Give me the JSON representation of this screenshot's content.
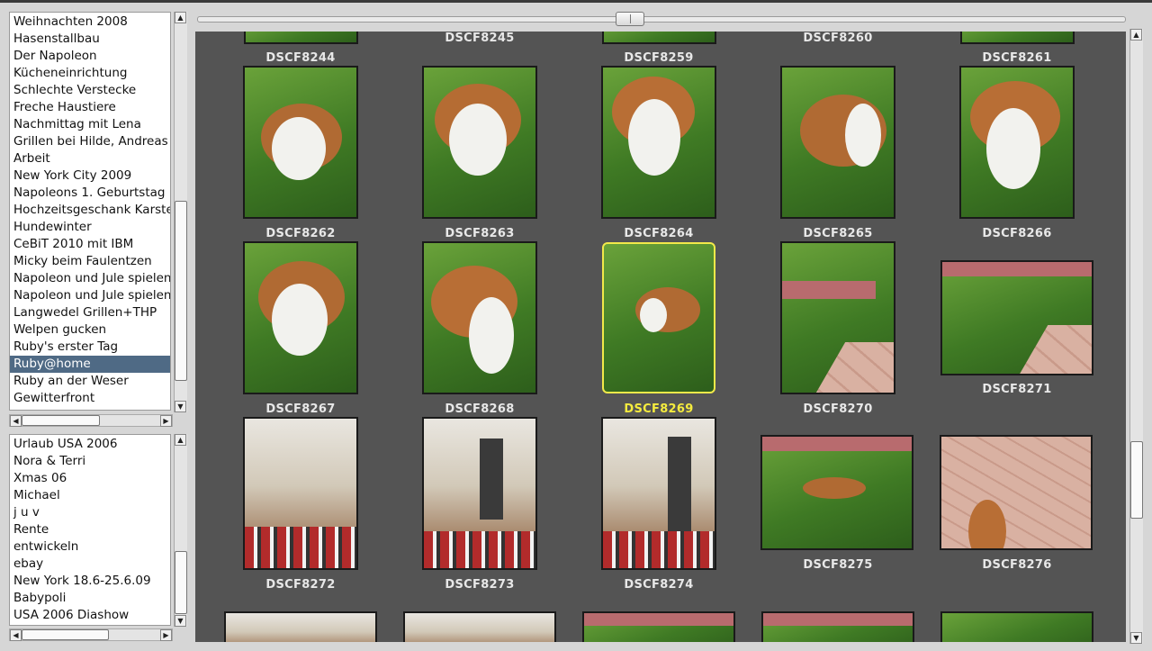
{
  "albums_top": {
    "items": [
      "Weihnachten 2008",
      "Hasenstallbau",
      "Der Napoleon",
      "Kücheneinrichtung",
      "Schlechte Verstecke",
      "Freche Haustiere",
      "Nachmittag mit Lena",
      "Grillen bei Hilde, Andreas u",
      "Arbeit",
      "New York City 2009",
      "Napoleons 1. Geburtstag",
      "Hochzeitsgeschank Karsten",
      "Hundewinter",
      "CeBiT 2010 mit IBM",
      "Micky beim Faulentzen",
      "Napoleon und Jule spielen",
      "Napoleon und Jule spielen",
      "Langwedel Grillen+THP",
      "Welpen gucken",
      "Ruby's erster Tag",
      "Ruby@home",
      "Ruby an der Weser",
      "Gewitterfront"
    ],
    "selected": "Ruby@home"
  },
  "albums_bottom": {
    "items": [
      "Urlaub USA 2006",
      "Nora & Terri",
      "Xmas 06",
      "Michael",
      "j u v",
      "Rente",
      "entwickeln",
      "ebay",
      "New York 18.6-25.6.09",
      "Babypoli",
      "USA 2006 Diashow"
    ]
  },
  "gallery": {
    "captions_partial_row": [
      "DSCF8245",
      "DSCF8260"
    ],
    "row0_labels": [
      "DSCF8244",
      "DSCF8259",
      "DSCF8261"
    ],
    "row1_labels": [
      "DSCF8262",
      "DSCF8263",
      "DSCF8264",
      "DSCF8265",
      "DSCF8266"
    ],
    "row2_labels": [
      "DSCF8267",
      "DSCF8268",
      "DSCF8269",
      "DSCF8270",
      "DSCF8271"
    ],
    "row3_labels": [
      "DSCF8272",
      "DSCF8273",
      "DSCF8274",
      "DSCF8275",
      "DSCF8276"
    ],
    "selected_photo": "DSCF8269",
    "highlight_color": "#f5ec3e",
    "background_color": "#545454"
  },
  "icons": {
    "up": "▲",
    "down": "▼",
    "left": "◀",
    "right": "▶"
  }
}
